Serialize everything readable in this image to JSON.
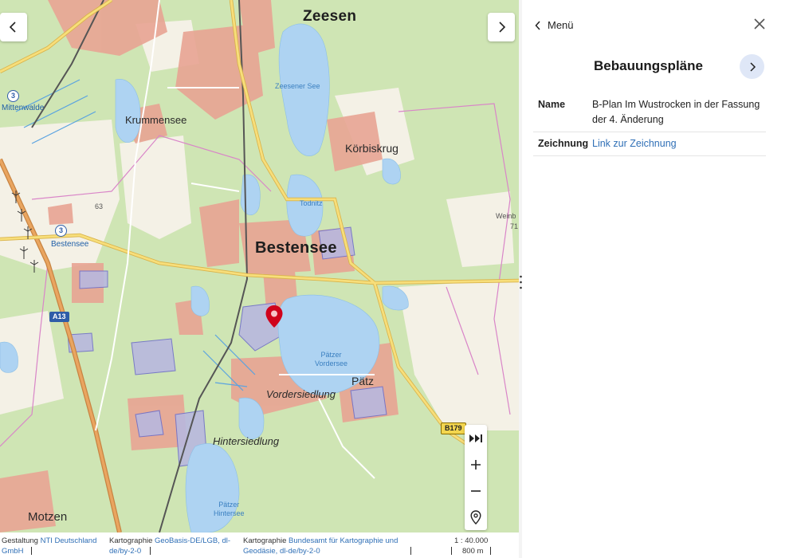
{
  "map": {
    "places": {
      "zeesen": "Zeesen",
      "mittenwalde": "Mittenwalde",
      "krummensee": "Krummensee",
      "koerbiskrug": "Körbiskrug",
      "bestensee": "Bestensee",
      "bestensee_small": "Bestensee",
      "vordersiedlung": "Vordersiedlung",
      "paetz": "Pätz",
      "hintersiedlung": "Hintersiedlung",
      "motzen": "Motzen",
      "weinb": "Weinb"
    },
    "lakes": {
      "zeesener_see": "Zeesener See",
      "todnitz": "Todnitz",
      "paetzer_vordersee": [
        "Pätzer",
        "Vordersee"
      ],
      "paetzer_hintersee": [
        "Pätzer",
        "Hintersee"
      ]
    },
    "road_shields": {
      "a13": "A13",
      "b179": "B179",
      "exit3_top": "3",
      "exit3_mid": "3"
    },
    "spot_heights": {
      "h63": "63",
      "h71": "71"
    },
    "marker_color": "#d0021b"
  },
  "footer": {
    "col1_prefix": "Gestaltung ",
    "col1_link": "NTI Deutschland",
    "col1_link2": "GmbH",
    "col2_prefix": "Kartographie ",
    "col2_link": "GeoBasis-DE/LGB, dl-",
    "col2_link2": "de/by-2-0",
    "col3_prefix": "Kartographie ",
    "col3_link": "Bundesamt für Kartographie und",
    "col3_link2": "Geodäsie, dl-de/by-2-0",
    "scale_ratio": "1 : 40.000",
    "scale_distance": "800 m"
  },
  "panel": {
    "back_label": "Menü",
    "title": "Bebauungspläne",
    "rows": [
      {
        "key": "Name",
        "value": "B-Plan Im Wustrocken in der Fassung der 4. Änderung"
      },
      {
        "key": "Zeichnung",
        "link": "Link zur Zeichnung"
      }
    ]
  },
  "colors": {
    "link": "#2f6fb6",
    "accent_circle": "#dfe7f7",
    "water": "#aed3f2",
    "forest": "#cfe5b4"
  }
}
